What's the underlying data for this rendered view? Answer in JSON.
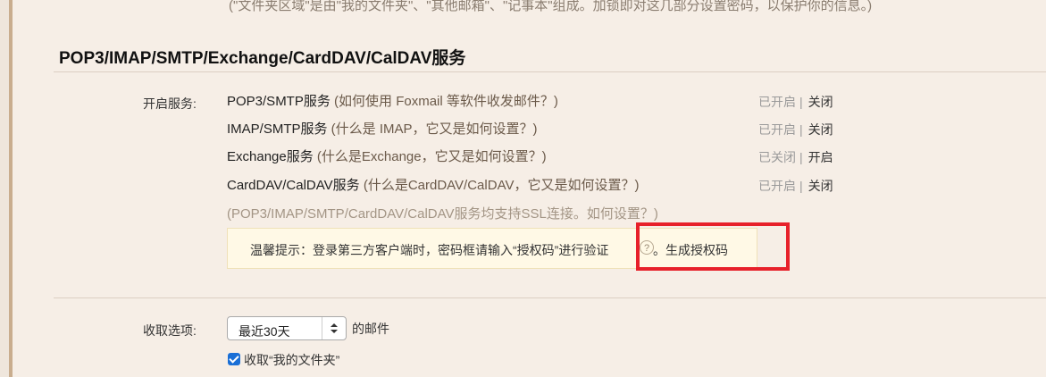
{
  "top_note": "(\"文件夹区域\"是由\"我的文件夹\"、\"其他邮箱\"、\"记事本\"组成。加锁即对这几部分设置密码，以保护你的信息。)",
  "section": {
    "title": "POP3/IMAP/SMTP/Exchange/CardDAV/CalDAV服务"
  },
  "services": {
    "label": "开启服务:",
    "rows": [
      {
        "name": "POP3/SMTP服务",
        "desc": " (如何使用 Foxmail 等软件收发邮件？)",
        "status": "已开启",
        "sep": "|",
        "action": "关闭"
      },
      {
        "name": "IMAP/SMTP服务",
        "desc": " (什么是 IMAP，它又是如何设置？)",
        "status": "已开启",
        "sep": "|",
        "action": "关闭"
      },
      {
        "name": "Exchange服务",
        "desc": " (什么是Exchange，它又是如何设置？)",
        "status": "已关闭",
        "sep": "|",
        "action": "开启"
      },
      {
        "name": "CardDAV/CalDAV服务",
        "desc": " (什么是CardDAV/CalDAV，它又是如何设置？)",
        "status": "已开启",
        "sep": "|",
        "action": "关闭"
      }
    ],
    "ssl_note": "(POP3/IMAP/SMTP/CardDAV/CalDAV服务均支持SSL连接。如何设置？)"
  },
  "tip": {
    "text": "温馨提示：登录第三方客户端时，密码框请输入“授权码”进行验证",
    "help_glyph": "?",
    "generate_link": "。生成授权码"
  },
  "receive": {
    "label": "收取选项:",
    "select_value": "最近30天",
    "suffix": "的邮件",
    "checkbox_label": "收取“我的文件夹”",
    "checkbox_checked": true
  },
  "colors": {
    "background": "#f6eee6",
    "highlight": "#e7212a",
    "checkbox": "#1a6fd6"
  }
}
